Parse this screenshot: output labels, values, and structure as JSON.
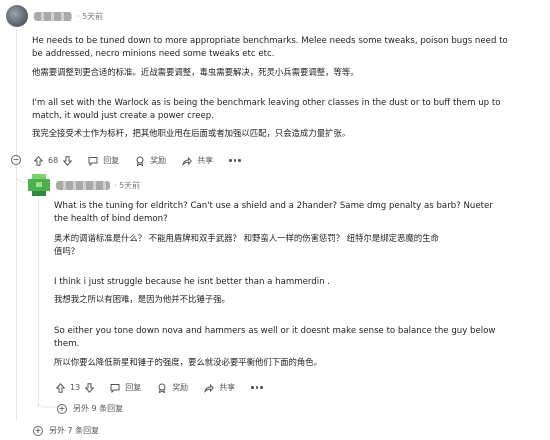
{
  "comment1": {
    "time": "5天前",
    "en1": [
      "He needs to be tuned down to more appropriate benchmarks. Melee needs some tweaks, poison bugs need to",
      "be addressed, necro minions need some tweaks etc etc."
    ],
    "cn1": "他需要调整到更合适的标准。近战需要调整，毒虫需要解决，死灵小兵需要调整，等等。",
    "en2": [
      "I'm all set with the Warlock as is being the benchmark leaving other classes in the dust or to buff them up to",
      "match, it would just create a power creep."
    ],
    "cn2": "我完全接受术士作为标杆，把其他职业甩在后面或者加强以匹配，只会造成力量扩张。",
    "votes": "68",
    "reply": "回复",
    "award": "奖励",
    "share": "共享"
  },
  "comment2": {
    "time": "5天前",
    "en1": [
      "What is the tuning for eldritch?  Can't use a shield and a 2hander?  Same dmg penalty as barb?  Nueter",
      "the health of bind demon?"
    ],
    "cn1": [
      "奥术的调谐标准是什么？ 不能用盾牌和双手武器？ 和野蛮人一样的伤害惩罚？ 纽特尔是绑定恶魔的生命",
      "值吗？"
    ],
    "en2": "I think i just struggle because he isnt better than a hammerdin .",
    "cn2": "我想我之所以有困难，是因为他并不比锤子强。",
    "en3": [
      "So either you tone down nova and hammers as well or it doesnt make sense to balance the guy below",
      "them."
    ],
    "cn3": "所以你要么降低新星和锤子的强度，要么就没必要平衡他们下面的角色。",
    "votes": "13",
    "reply": "回复",
    "award": "奖励",
    "share": "共享"
  },
  "more_replies_nested": "另外 9 条回复",
  "more_replies": "另外 7 条回复",
  "colors": {
    "avatar2": "#4caf50",
    "thread_line": "#e4e6e8"
  }
}
